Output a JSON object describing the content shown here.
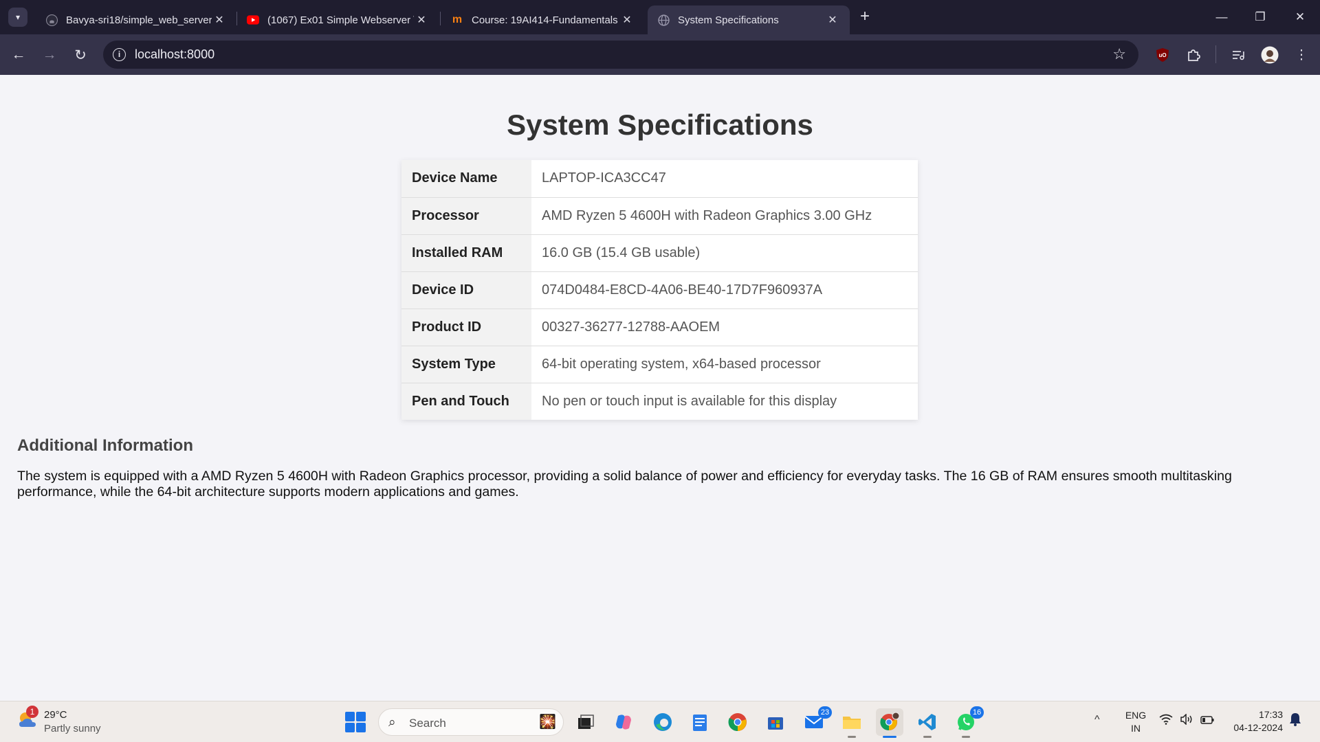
{
  "browser": {
    "tabs": [
      {
        "title": "Bavya-sri18/simple_web_server",
        "icon": "github-icon",
        "active": false
      },
      {
        "title": "(1067) Ex01 Simple Webserver \\",
        "icon": "youtube-icon",
        "active": false
      },
      {
        "title": "Course: 19AI414-Fundamentals",
        "icon": "moodle-icon",
        "active": false
      },
      {
        "title": "System Specifications",
        "icon": "globe-icon",
        "active": true
      }
    ],
    "url": "localhost:8000",
    "colors": {
      "tabbar": "#1f1d2f",
      "toolbar": "#35334a",
      "omnibox": "#1f1d2f"
    }
  },
  "page": {
    "title": "System Specifications",
    "specs": [
      {
        "label": "Device Name",
        "value": "LAPTOP-ICA3CC47"
      },
      {
        "label": "Processor",
        "value": "AMD Ryzen 5 4600H with Radeon Graphics 3.00 GHz"
      },
      {
        "label": "Installed RAM",
        "value": "16.0 GB (15.4 GB usable)"
      },
      {
        "label": "Device ID",
        "value": "074D0484-E8CD-4A06-BE40-17D7F960937A"
      },
      {
        "label": "Product ID",
        "value": "00327-36277-12788-AAOEM"
      },
      {
        "label": "System Type",
        "value": "64-bit operating system, x64-based processor"
      },
      {
        "label": "Pen and Touch",
        "value": "No pen or touch input is available for this display"
      }
    ],
    "additional_heading": "Additional Information",
    "additional_text": "The system is equipped with a AMD Ryzen 5 4600H with Radeon Graphics processor, providing a solid balance of power and efficiency for everyday tasks. The 16 GB of RAM ensures smooth multitasking performance, while the 64-bit architecture supports modern applications and games."
  },
  "taskbar": {
    "weather": {
      "temp": "29°C",
      "desc": "Partly sunny",
      "badge": "1"
    },
    "search_label": "Search",
    "badges": {
      "mail": "23",
      "whatsapp": "16"
    },
    "language": {
      "line1": "ENG",
      "line2": "IN"
    },
    "time": "17:33",
    "date": "04-12-2024"
  }
}
